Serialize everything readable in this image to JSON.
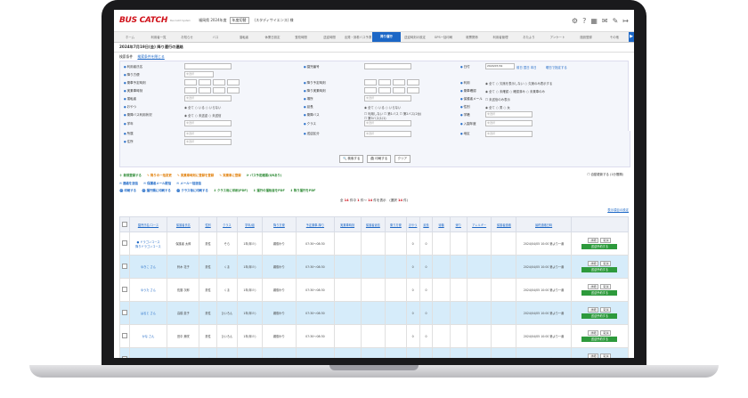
{
  "header": {
    "logo": "BUS CATCH",
    "logo_sub": "Bus Catch System",
    "school": "福岡県 2024年度",
    "chip": "年度切替",
    "user": "(スタディサイエンス) 様",
    "icons": [
      "gear-icon",
      "help-icon",
      "grid-icon",
      "mail-icon",
      "edit-icon",
      "logout-icon"
    ]
  },
  "nav": [
    "ホーム",
    "利用者一覧",
    "お知らせ",
    "バス",
    "運転者",
    "休業日設定",
    "登校時間",
    "送迎時間",
    "出発・到着バス予測",
    "降り運行",
    "送迎時刻の設定",
    "GPS一括印刷",
    "帳票関係",
    "利用者管理",
    "おたより",
    "アンケート",
    "施設登録",
    "その他"
  ],
  "nav_active": 9,
  "page_title": "2024年7月19日(金) 降り運行の連絡",
  "cond": {
    "heading": "検索条件",
    "toggle": "検索条件を閉じる",
    "r1": {
      "a": "利用者氏名",
      "b": "園児番号",
      "c": "日付",
      "date": "2024/07/19",
      "links": "前日 翌日 本日",
      "links2": "曜日で指定する"
    },
    "r2": {
      "a": "降り方便"
    },
    "r3": {
      "a": "乗車予定時刻",
      "b": "降り予定時刻",
      "c": "利用",
      "opts": [
        "全て",
        "欠席を表示しない",
        "欠席のみ表示する"
      ]
    },
    "r4": {
      "a": "実乗車時刻",
      "b": "降り実乗時刻",
      "c": "乗車確認",
      "opts": [
        "全て",
        "未確認",
        "確認済み",
        "未乗車のみ"
      ]
    },
    "r5": {
      "a": "運転者",
      "b": "場所",
      "c": "保護者メール",
      "opt": "未送信のみ表示"
    },
    "r6": {
      "a": "おやつ",
      "opts": [
        "全て",
        "いる",
        "いらない"
      ],
      "b": "延長",
      "opts2": [
        "全て",
        "いる",
        "いらない"
      ],
      "c": "性別",
      "opts3": [
        "全て",
        "男",
        "女"
      ]
    },
    "r7": {
      "a": "乗降バス利用状況",
      "opts": [
        "全て",
        "未送迎",
        "未送信"
      ],
      "b": "乗降バス",
      "opts2": [
        "利用しない",
        "第1バス",
        "第2バス(2台)",
        "第3バス(1/1)"
      ],
      "c": "学籍"
    },
    "r8": {
      "a": "学年",
      "b": "クラス",
      "c": "入園年度"
    },
    "r9": {
      "a": "所属",
      "b": "送迎区分",
      "c": "地区"
    },
    "r10": {
      "a": "住所"
    },
    "placeholder": "未選択",
    "btn_search": "検索する",
    "btn_print": "印刷する",
    "btn_clear": "クリア"
  },
  "actions": {
    "row1": [
      "新規登録する",
      "降りの一括変更",
      "実乗車時刻に登録を登録",
      "実乗車に登録",
      "バス予定確認(QRあり)"
    ],
    "row2": [
      "連絡を送信",
      "保護者メール配信",
      "メール一括送信"
    ],
    "row3": [
      "印刷する",
      "運行順に印刷する",
      "クラス毎に印刷する",
      "クラス毎に印刷(PDF)",
      "運行の運転者をPDF",
      "降り運行をPDF"
    ],
    "right_check": "自動更新する (1分間隔)"
  },
  "count": {
    "prefix": "全",
    "total": "14",
    "mid": "件中",
    "from": "1",
    "to": "14",
    "suffix": "件を表示",
    "sel": "(選択",
    "sel_n": "14",
    "sel_end": "件)"
  },
  "table_link": "表示項目の設定",
  "table": {
    "headers": [
      "",
      "園児氏名/コース",
      "保護者氏名",
      "性別",
      "クラス",
      "学年/組",
      "降り方便",
      "予定乗車-降り",
      "実乗車時刻",
      "保護者返信",
      "乗り方便",
      "おやつ",
      "延長",
      "待機",
      "帰り",
      "アレルギー",
      "保護者連絡",
      "最終連絡日時",
      ""
    ],
    "rows": [
      {
        "hl": false,
        "name": "● ドラゴンコース",
        "sub": "降りドラゴンコース",
        "parent": "保護者 太郎",
        "sex": "男性",
        "cls": "そら",
        "grade": "1年(年少)",
        "route": "親御かり",
        "time": "07:30〜08:30",
        "a": "0",
        "b": "0",
        "sent": "2024/04/05 10:00 第より一番",
        "green": "送迎予約する"
      },
      {
        "hl": true,
        "name": "ゆきこ さん",
        "sub": "",
        "parent": "鈴木 花子",
        "sex": "男性",
        "cls": "くま",
        "grade": "1年(年少)",
        "route": "親御かり",
        "time": "07:30〜08:30",
        "a": "0",
        "b": "0",
        "sent": "2024/04/05 10:00 第より一番",
        "green": "送迎予約する"
      },
      {
        "hl": false,
        "name": "ゆうた さん",
        "sub": "",
        "parent": "佐藤 次郎",
        "sex": "男性",
        "cls": "くま",
        "grade": "1年(年少)",
        "route": "親御かり",
        "time": "07:30〜08:30",
        "a": "0",
        "b": "0",
        "sent": "2024/04/05 10:00 第より一番",
        "green": "送迎予約する"
      },
      {
        "hl": true,
        "name": "はると さん",
        "sub": "",
        "parent": "高橋 恵子",
        "sex": "男性",
        "cls": "ひいろん",
        "grade": "1年(年少)",
        "route": "親御かり",
        "time": "07:30〜08:30",
        "a": "0",
        "b": "0",
        "sent": "2024/04/05 10:00 第より一番",
        "green": "送迎予約する"
      },
      {
        "hl": false,
        "name": "かな さん",
        "sub": "",
        "parent": "田中 美咲",
        "sex": "男性",
        "cls": "ひいろん",
        "grade": "1年(年少)",
        "route": "親御かり",
        "time": "07:30〜08:30",
        "a": "0",
        "b": "0",
        "sent": "2024/04/05 10:00 第より一番",
        "green": "送迎予約する"
      },
      {
        "hl": true,
        "name": "そうた さん",
        "sub": "",
        "parent": "伊藤 正一",
        "sex": "男性",
        "cls": "ひいろん",
        "grade": "1年(年少)",
        "route": "親御かり",
        "time": "07:30〜08:30",
        "a": "0",
        "b": "0",
        "sent": "2024/04/05 10:00 第より一番",
        "green": "送迎予約する"
      },
      {
        "hl": false,
        "name": "みお さん",
        "sub": "",
        "parent": "山本 二郎",
        "sex": "男性",
        "cls": "ぞう",
        "grade": "2年(年中)",
        "route": "市区町村の送迎可能",
        "time": "07:30〜08:30",
        "a": "0",
        "b": "0",
        "sent": "2024/04/05 09:30 第より一番",
        "green": ""
      }
    ],
    "btn_detail": "詳細",
    "btn_edit": "取消"
  }
}
